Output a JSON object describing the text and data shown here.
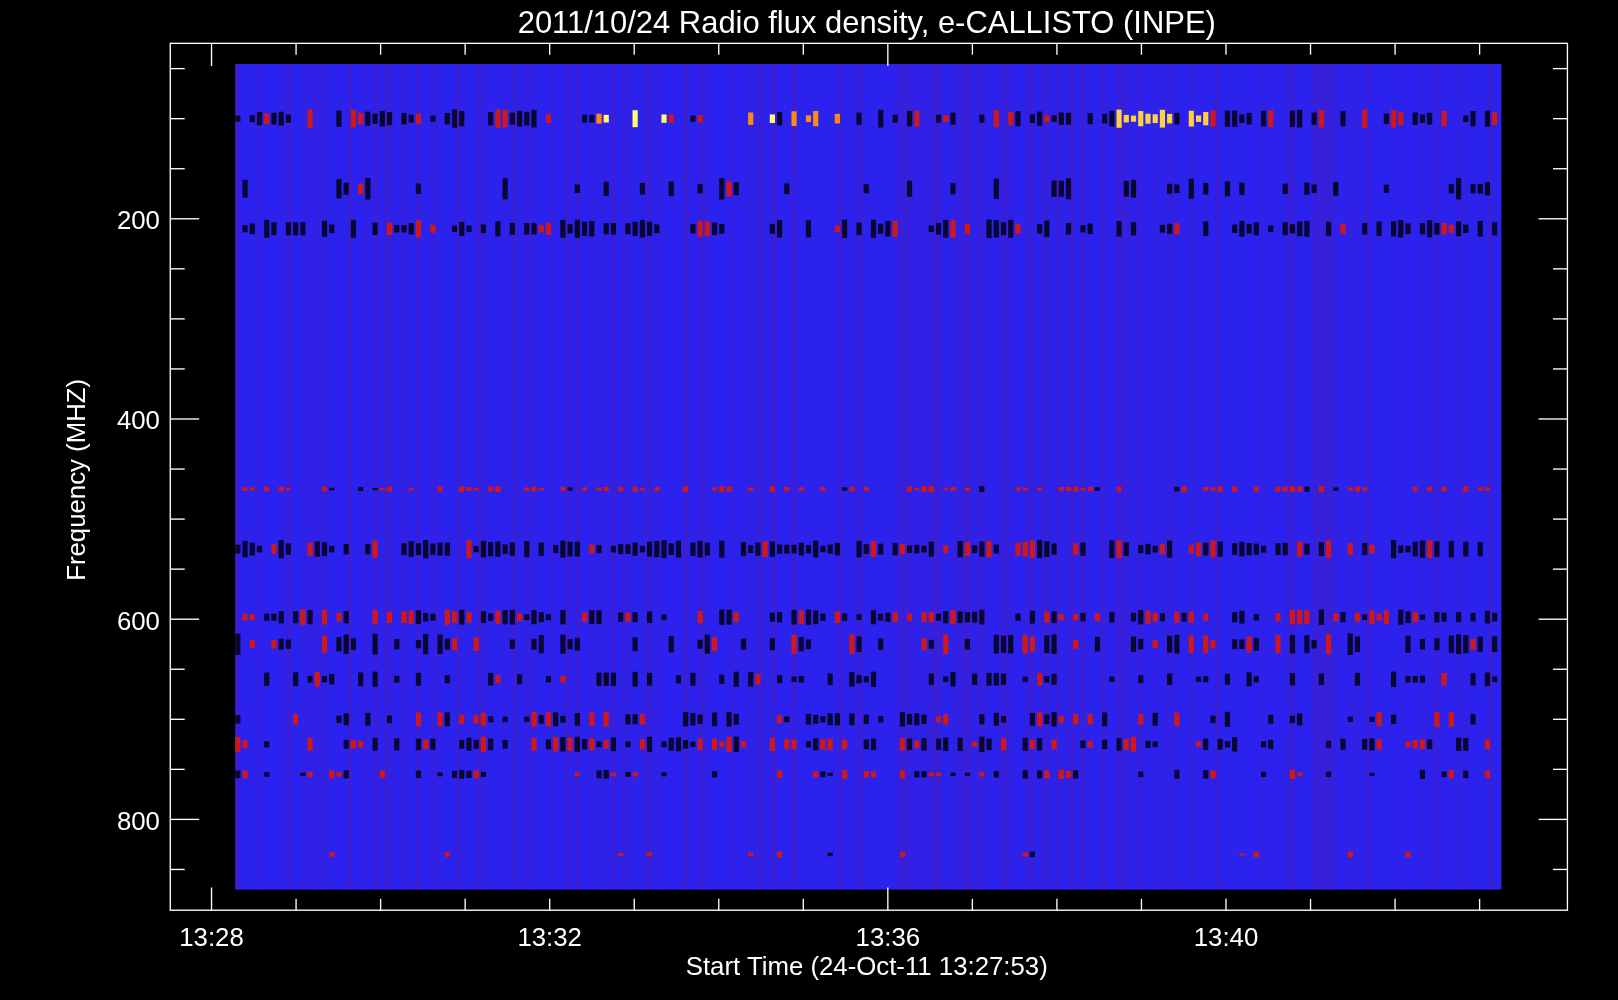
{
  "title": "2011/10/24  Radio flux density, e-CALLISTO (INPE)",
  "y_axis": {
    "label": "Frequency (MHZ)",
    "ticks": [
      "200",
      "400",
      "600",
      "800"
    ]
  },
  "x_axis": {
    "label": "Start Time (24-Oct-11 13:27:53)",
    "ticks": [
      "13:28",
      "13:32",
      "13:36",
      "13:40"
    ]
  }
}
